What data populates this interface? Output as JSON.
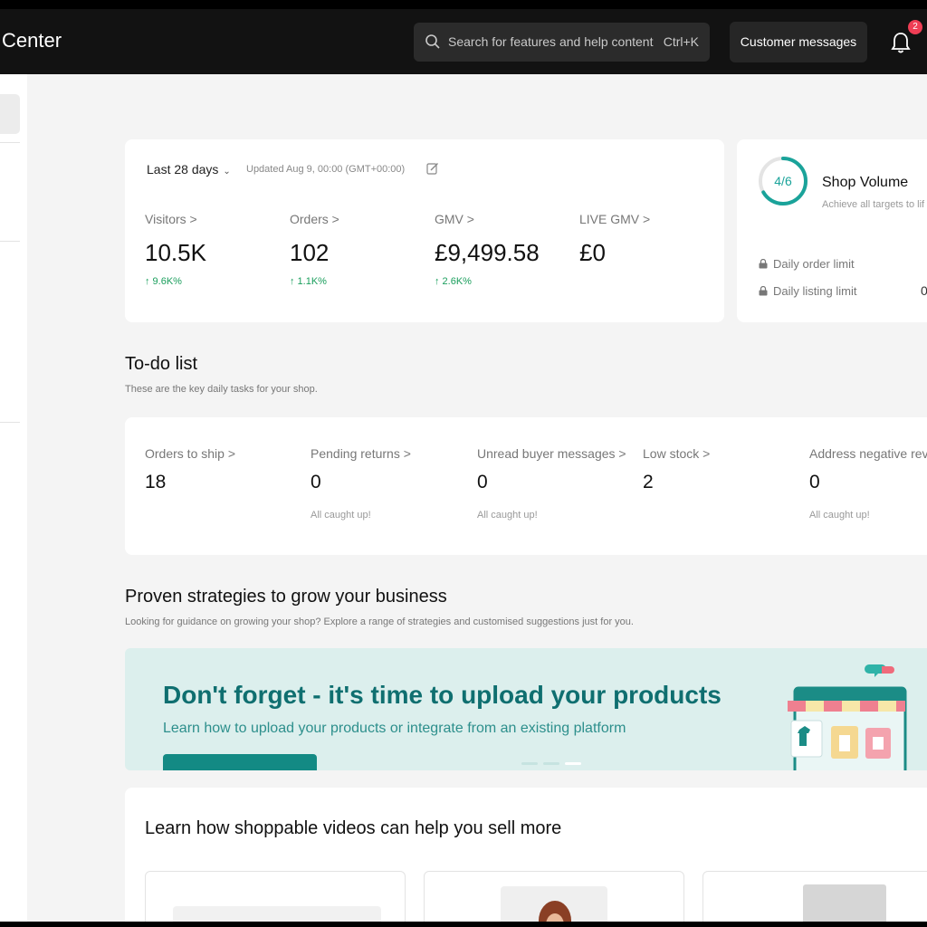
{
  "header": {
    "brand": "Center",
    "search_placeholder": "Search for features and help content",
    "search_shortcut": "Ctrl+K",
    "customer_messages": "Customer messages",
    "notification_count": "2"
  },
  "stats": {
    "range": "Last 28 days",
    "updated": "Updated Aug 9, 00:00 (GMT+00:00)",
    "items": [
      {
        "label": "Visitors >",
        "value": "10.5K",
        "change": "↑ 9.6K%"
      },
      {
        "label": "Orders >",
        "value": "102",
        "change": "↑ 1.1K%"
      },
      {
        "label": "GMV >",
        "value": "£9,499.58",
        "change": "↑ 2.6K%"
      },
      {
        "label": "LIVE GMV >",
        "value": "£0",
        "change": ""
      }
    ]
  },
  "shop_volume": {
    "progress_text": "4/6",
    "progress": 0.6667,
    "title": "Shop Volume",
    "subtitle": "Achieve all targets to lif",
    "limits": [
      "Daily order limit",
      "Daily listing limit"
    ],
    "listing_value": "0"
  },
  "todo": {
    "title": "To-do list",
    "subtitle": "These are the key daily tasks for your shop.",
    "items": [
      {
        "label": "Orders to ship >",
        "value": "18",
        "note": ""
      },
      {
        "label": "Pending returns >",
        "value": "0",
        "note": "All caught up!"
      },
      {
        "label": "Unread buyer messages >",
        "value": "0",
        "note": "All caught up!"
      },
      {
        "label": "Low stock >",
        "value": "2",
        "note": ""
      },
      {
        "label": "Address negative revie",
        "value": "0",
        "note": "All caught up!"
      }
    ]
  },
  "strategies": {
    "title": "Proven strategies to grow your business",
    "subtitle": "Looking for guidance on growing your shop? Explore a range of strategies and customised suggestions just for you."
  },
  "banner": {
    "headline": "Don't forget - it's time to upload your products",
    "subline": "Learn how to upload your products or integrate from an existing platform"
  },
  "learn": {
    "title": "Learn how shoppable videos can help you sell more"
  },
  "colors": {
    "accent": "#1aa39a",
    "positive": "#1a9e5c",
    "badge": "#ef3e55",
    "banner_bg": "#dcefed"
  }
}
